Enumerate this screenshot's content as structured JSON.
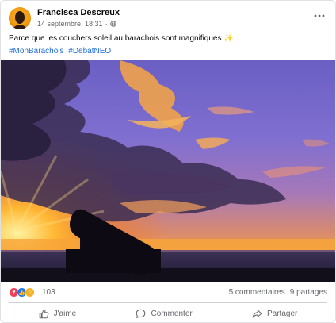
{
  "post": {
    "author": "Francisca Descreux",
    "date": "14 septembre, 18:31",
    "separator": "·",
    "text": "Parce que les couchers soleil au barachois sont magnifiques",
    "emoji": "✨",
    "hashtags": [
      "#MonBarachois",
      "#DebatNEO"
    ]
  },
  "stats": {
    "reaction_count": "103",
    "reactions": [
      "like",
      "love",
      "wow"
    ],
    "comments": "5 commentaires",
    "shares": "9 partages"
  },
  "actions": {
    "like": "J'aime",
    "comment": "Commenter",
    "share": "Partager"
  },
  "colors": {
    "link": "#216fdb",
    "muted": "#65676b",
    "like": "#1877f2",
    "love": "#f33e58",
    "wow": "#f7b125"
  },
  "icons": {
    "more": "ellipsis-icon",
    "privacy": "globe-icon",
    "like": "thumbs-up-icon",
    "comment": "comment-bubble-icon",
    "share": "share-arrow-icon"
  }
}
